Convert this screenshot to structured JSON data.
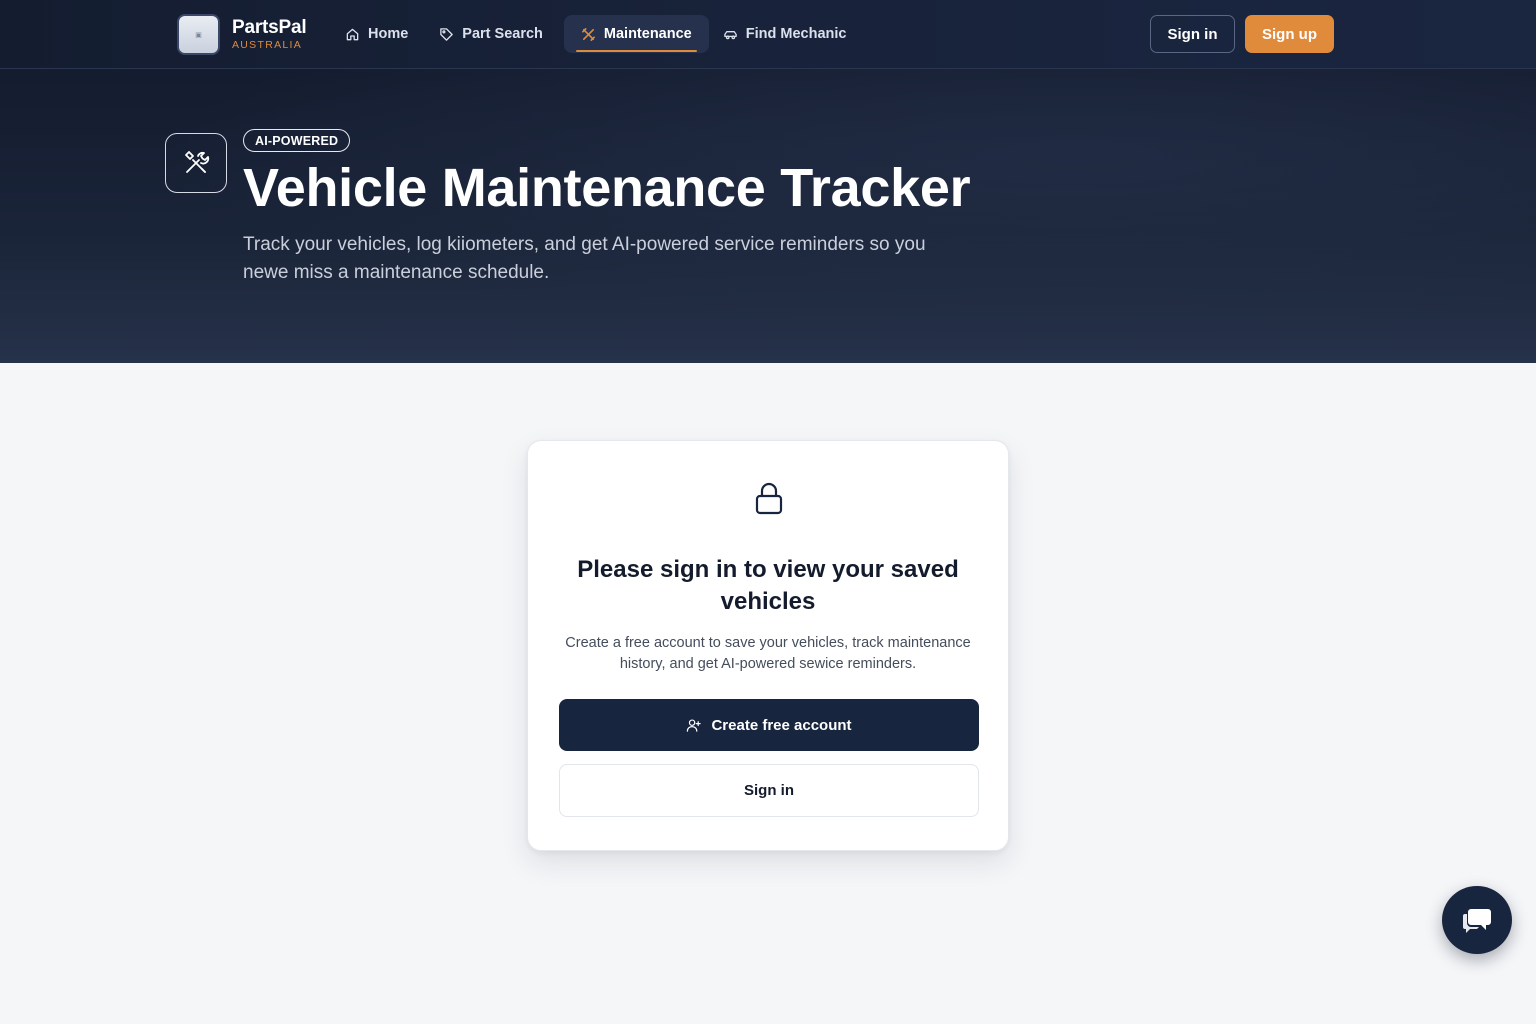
{
  "brand": {
    "name": "PartsPal",
    "subtitle": "AUSTRALIA",
    "accent_color": "#e08a3c",
    "navy_color": "#18253f"
  },
  "nav": {
    "links": [
      {
        "label": "Home",
        "icon": "home-icon",
        "active": false
      },
      {
        "label": "Part Search",
        "icon": "tag-icon",
        "active": false
      },
      {
        "label": "Maintenance",
        "icon": "tools-icon",
        "active": true
      },
      {
        "label": "Find Mechanic",
        "icon": "car-icon",
        "active": false
      }
    ],
    "sign_in_label": "Sign in",
    "sign_up_label": "Sign up"
  },
  "hero": {
    "badge": "AI-POWERED",
    "title": "Vehicle Maintenance Tracker",
    "subtitle": "Track your vehicles, log kiiometers, and get AI-powered service reminders so you newe miss a maintenance schedule.",
    "icon": "tools-icon"
  },
  "card": {
    "icon": "lock-icon",
    "title": "Please sign in to view your saved vehicles",
    "text": "Create a free account to save your vehicles, track maintenance history, and get AI-powered sewice reminders.",
    "create_label": "Create free account",
    "create_icon": "user-plus-icon",
    "sign_in_label": "Sign in"
  },
  "chat": {
    "icon": "chat-icon"
  }
}
